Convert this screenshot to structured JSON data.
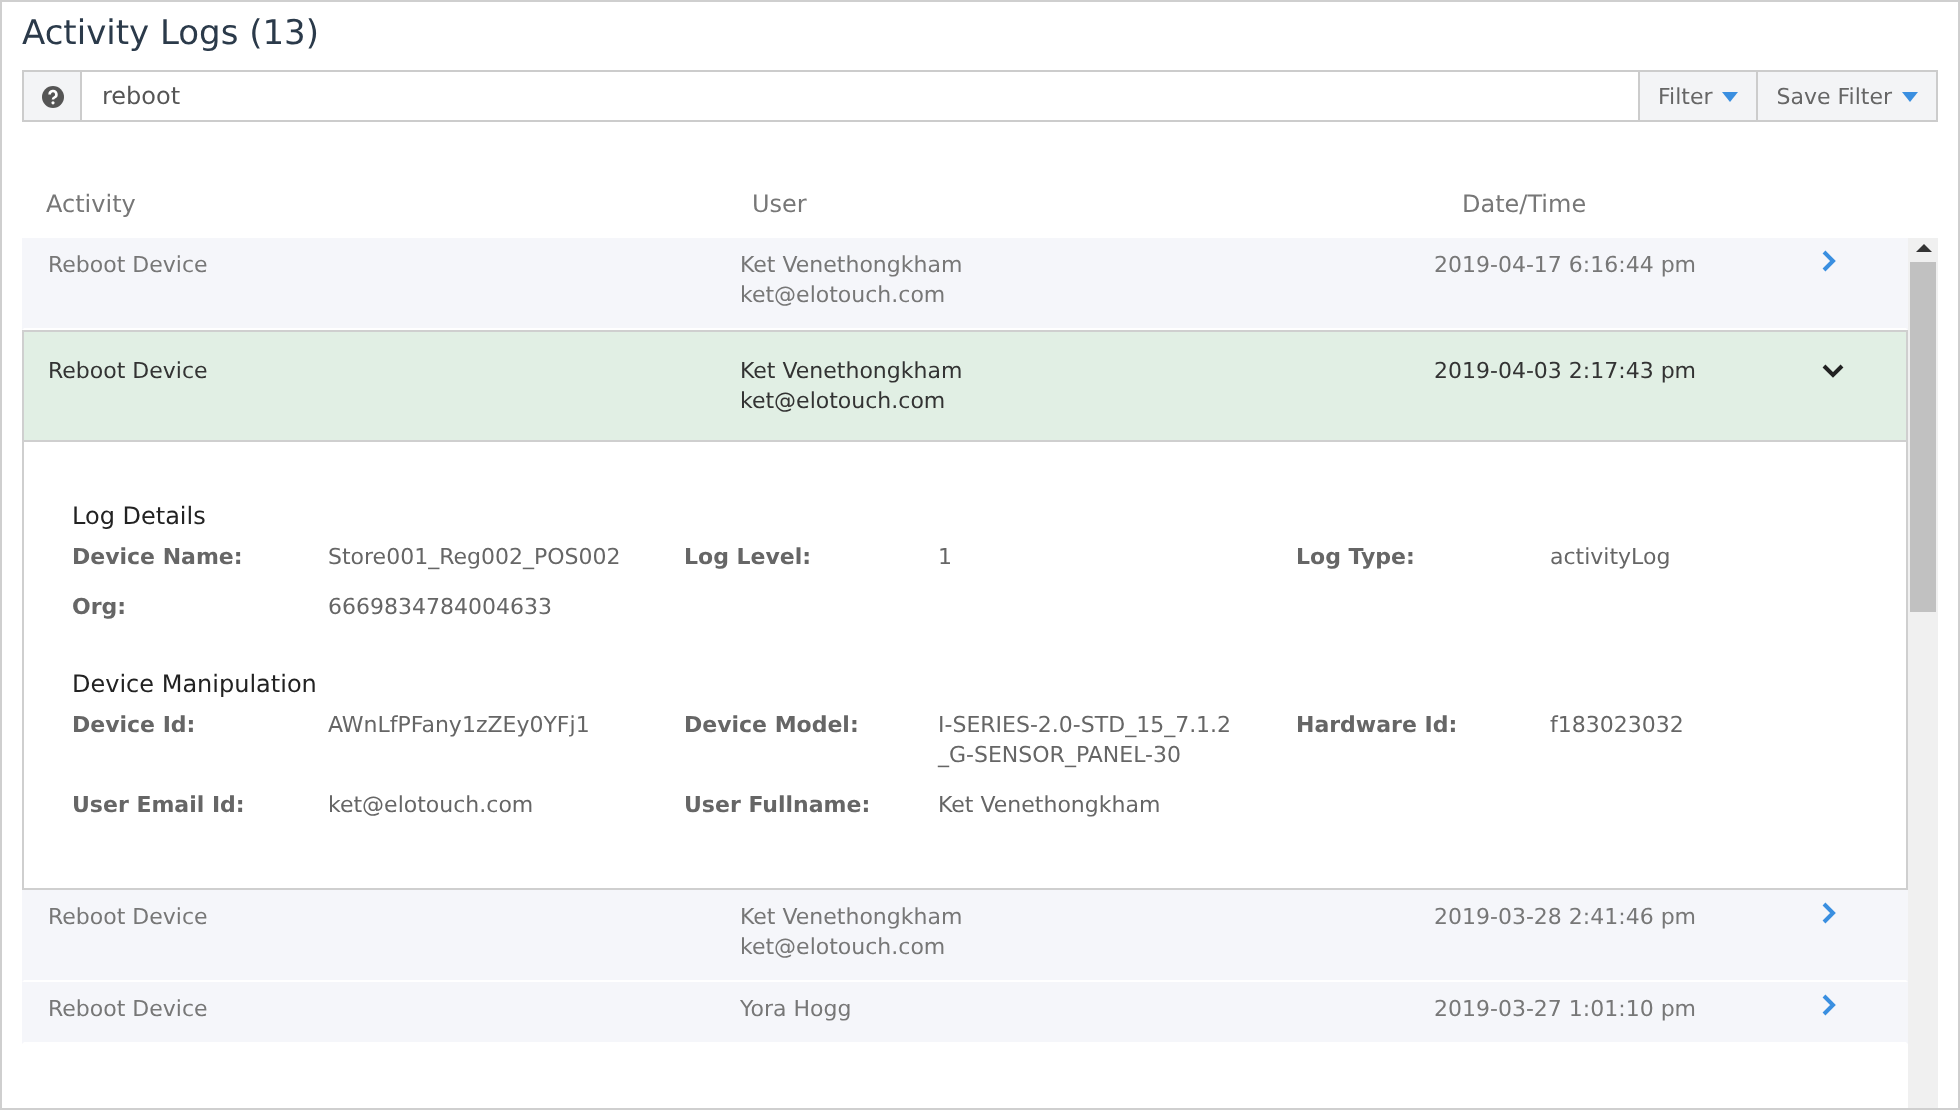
{
  "title": "Activity Logs (13)",
  "search": {
    "value": "reboot"
  },
  "buttons": [
    "Filter",
    "Save Filter"
  ],
  "columns": [
    "Activity",
    "User",
    "Date/Time"
  ],
  "logs": [
    {
      "activity": "Reboot Device",
      "user_name": "Ket Venethongkham",
      "user_email": "ket@elotouch.com",
      "datetime": "2019-04-17 6:16:44 pm",
      "expanded": false
    },
    {
      "activity": "Reboot Device",
      "user_name": "Ket Venethongkham",
      "user_email": "ket@elotouch.com",
      "datetime": "2019-04-03 2:17:43 pm",
      "expanded": true,
      "sections": [
        {
          "title": "Log Details",
          "fields": [
            {
              "label": "Device Name:",
              "value": "Store001_Reg002_POS002"
            },
            {
              "label": "Log Level:",
              "value": "1"
            },
            {
              "label": "Log Type:",
              "value": "activityLog"
            },
            {
              "label": "Org:",
              "value": "6669834784004633"
            }
          ]
        },
        {
          "title": "Device Manipulation",
          "fields": [
            {
              "label": "Device Id:",
              "value": "AWnLfPFany1zZEy0YFj1"
            },
            {
              "label": "Device Model:",
              "value": "I-SERIES-2.0-STD_15_7.1.2\n_G-SENSOR_PANEL-30"
            },
            {
              "label": "Hardware Id:",
              "value": "f183023032"
            },
            {
              "label": "User Email Id:",
              "value": "ket@elotouch.com"
            },
            {
              "label": "User Fullname:",
              "value": "Ket Venethongkham"
            }
          ]
        }
      ]
    },
    {
      "activity": "Reboot Device",
      "user_name": "Ket Venethongkham",
      "user_email": "ket@elotouch.com",
      "datetime": "2019-03-28 2:41:46 pm",
      "expanded": false
    },
    {
      "activity": "Reboot Device",
      "user_name": "Yora Hogg",
      "datetime": "2019-03-27 1:01:10 pm",
      "expanded": false
    }
  ]
}
